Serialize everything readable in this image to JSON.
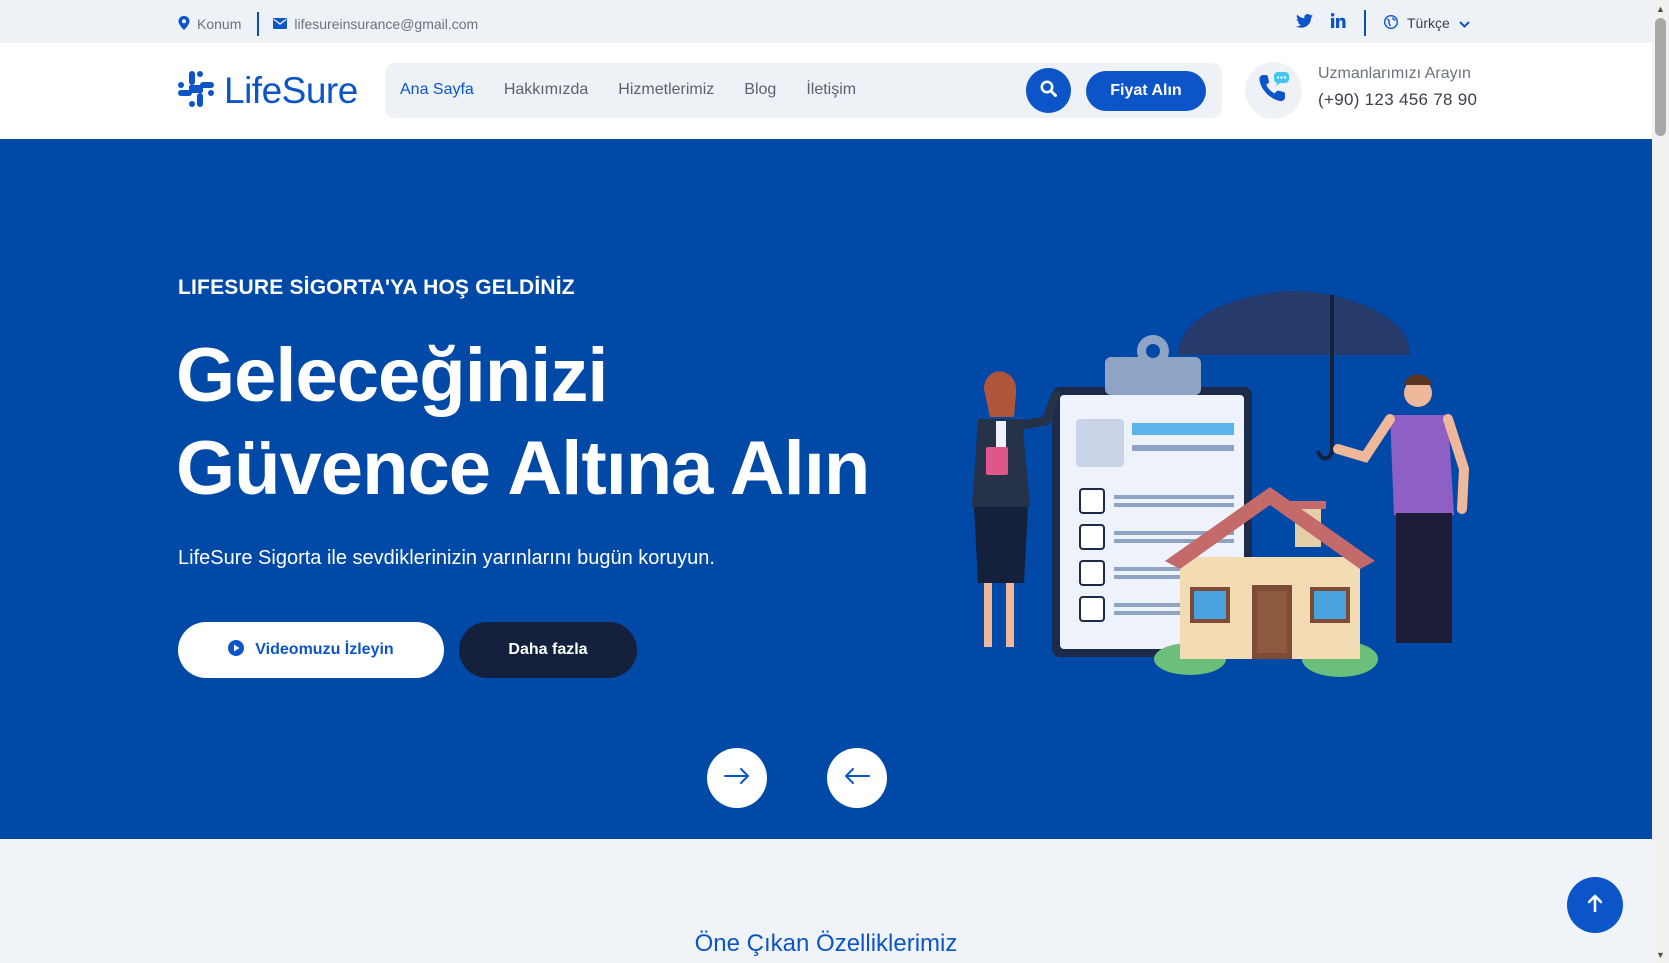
{
  "topbar": {
    "location": "Konum",
    "email": "lifesureinsurance@gmail.com",
    "language": "Türkçe"
  },
  "header": {
    "logo": "LifeSure",
    "nav": [
      "Ana Sayfa",
      "Hakkımızda",
      "Hizmetlerimiz",
      "Blog",
      "İletişim"
    ],
    "quote_button": "Fiyat Alın",
    "call_label": "Uzmanlarımızı Arayın",
    "call_phone": "(+90) 123 456 78 90"
  },
  "hero": {
    "eyebrow": "LIFESURE SİGORTA'YA HOŞ GELDİNİZ",
    "title_line1": "Geleceğinizi",
    "title_line2": "Güvence Altına Alın",
    "description": "LifeSure Sigorta ile sevdiklerinizin yarınlarını bugün koruyun.",
    "video_button": "Videomuzu İzleyin",
    "more_button": "Daha fazla"
  },
  "section": {
    "title": "Öne Çıkan Özelliklerimiz"
  },
  "colors": {
    "primary": "#0b55c9",
    "hero_bg": "#0049a6",
    "dark": "#14213d",
    "page_bg": "#f0f4f9"
  },
  "icons": [
    "map-pin-icon",
    "envelope-icon",
    "twitter-icon",
    "linkedin-icon",
    "globe-icon",
    "chevron-down-icon",
    "logo-icon",
    "search-icon",
    "phone-chat-icon",
    "play-icon",
    "arrow-right-icon",
    "arrow-left-icon",
    "arrow-up-icon"
  ]
}
